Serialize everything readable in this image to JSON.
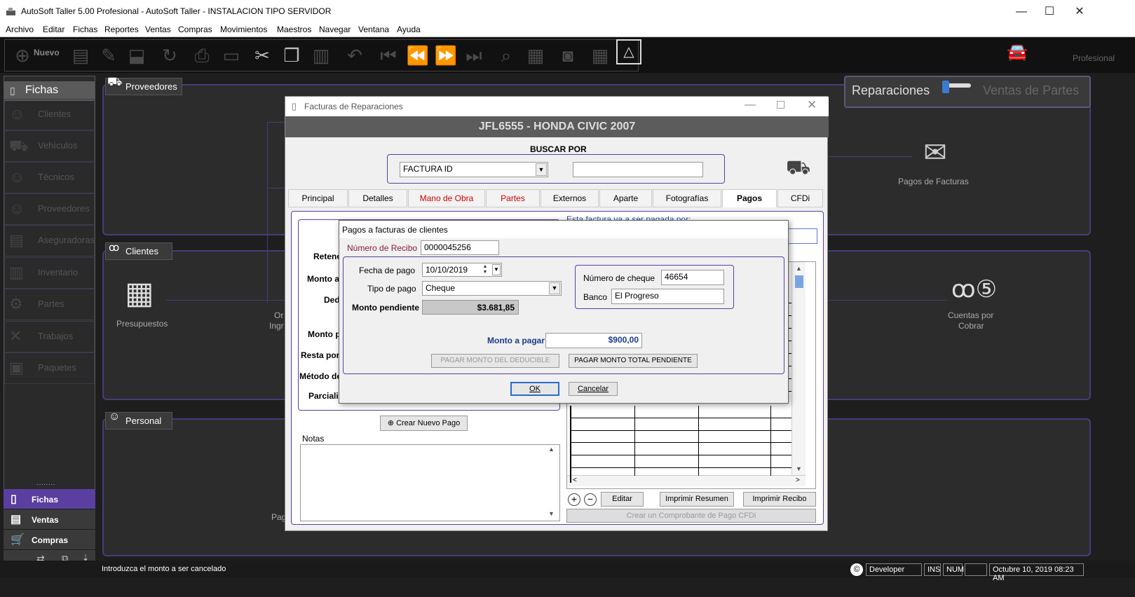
{
  "window": {
    "title": "AutoSoft Taller 5.00 Profesional - AutoSoft Taller - INSTALACION TIPO SERVIDOR",
    "min": "—",
    "max": "☐",
    "close": "✕"
  },
  "menu": [
    "Archivo",
    "Editar",
    "Fichas",
    "Reportes",
    "Ventas",
    "Compras",
    "Movimientos",
    "Maestros",
    "Navegar",
    "Ventana",
    "Ayuda"
  ],
  "toolbar": {
    "nuevo": "Nuevo",
    "edition": "Profesional"
  },
  "sidebar": {
    "header": "Fichas",
    "items": [
      "Clientes",
      "Vehículos",
      "Técnicos",
      "Proveedores",
      "Aseguradoras",
      "Inventario",
      "Partes",
      "Trabajos",
      "Paquetes"
    ],
    "bottom": [
      "Fichas",
      "Ventas",
      "Compras"
    ]
  },
  "background": {
    "proveedores": "Proveedores",
    "clientes": "Clientes",
    "personal": "Personal",
    "toggle_left": "Reparaciones",
    "toggle_right": "Ventas de Partes",
    "pagos_facturas": "Pagos de Facturas",
    "presupuestos": "Presupuestos",
    "cuentas1": "Cuentas por",
    "cuentas2": "Cobrar",
    "or": "Or",
    "ingr": "Ingr",
    "pag": "Pag"
  },
  "facturas": {
    "title": "Facturas de Reparaciones",
    "header": "JFL6555 - HONDA CIVIC 2007",
    "buscar_por": "BUSCAR POR",
    "search_field": "FACTURA ID",
    "search_value": "",
    "tabs": [
      "Principal",
      "Detalles",
      "Mano de Obra",
      "Partes",
      "Externos",
      "Aparte",
      "Fotografías",
      "Pagos",
      "CFDi"
    ],
    "paid_by": "Esta factura va a ser pagada por:",
    "left_labels": [
      "Reteno",
      "Monto a",
      "Dedu",
      "Monto p",
      "Resta por",
      "Método de",
      "Parcialic"
    ],
    "crear_nuevo_pago": "Crear Nuevo Pago",
    "notas": "Notas",
    "btn_editar": "Editar",
    "btn_resumen": "Imprimir Resumen",
    "btn_recibo": "Imprimir Recibo",
    "btn_cfdi": "Crear un Comprobante de Pago CFDi"
  },
  "dialog": {
    "title": "Pagos a facturas de clientes",
    "recibo_label": "Número de Recibo",
    "recibo": "0000045256",
    "fecha_label": "Fecha de pago",
    "fecha": "10/10/2019",
    "tipo_label": "Tipo de pago",
    "tipo": "Cheque",
    "pendiente_label": "Monto pendiente",
    "pendiente": "$3.681,85",
    "cheque_label": "Número de cheque",
    "cheque": "46654",
    "banco_label": "Banco",
    "banco": "El Progreso",
    "monto_label": "Monto a  pagar",
    "monto": "$900,00",
    "btn_deducible": "PAGAR MONTO DEL DEDUCIBLE",
    "btn_total": "PAGAR MONTO TOTAL PENDIENTE",
    "ok": "OK",
    "cancel": "Cancelar"
  },
  "status": {
    "message": "Introduzca el monto a ser cancelado",
    "user": "Developer",
    "ins": "INS",
    "num": "NUM",
    "date": "Octubre 10, 2019 08:23 AM"
  }
}
